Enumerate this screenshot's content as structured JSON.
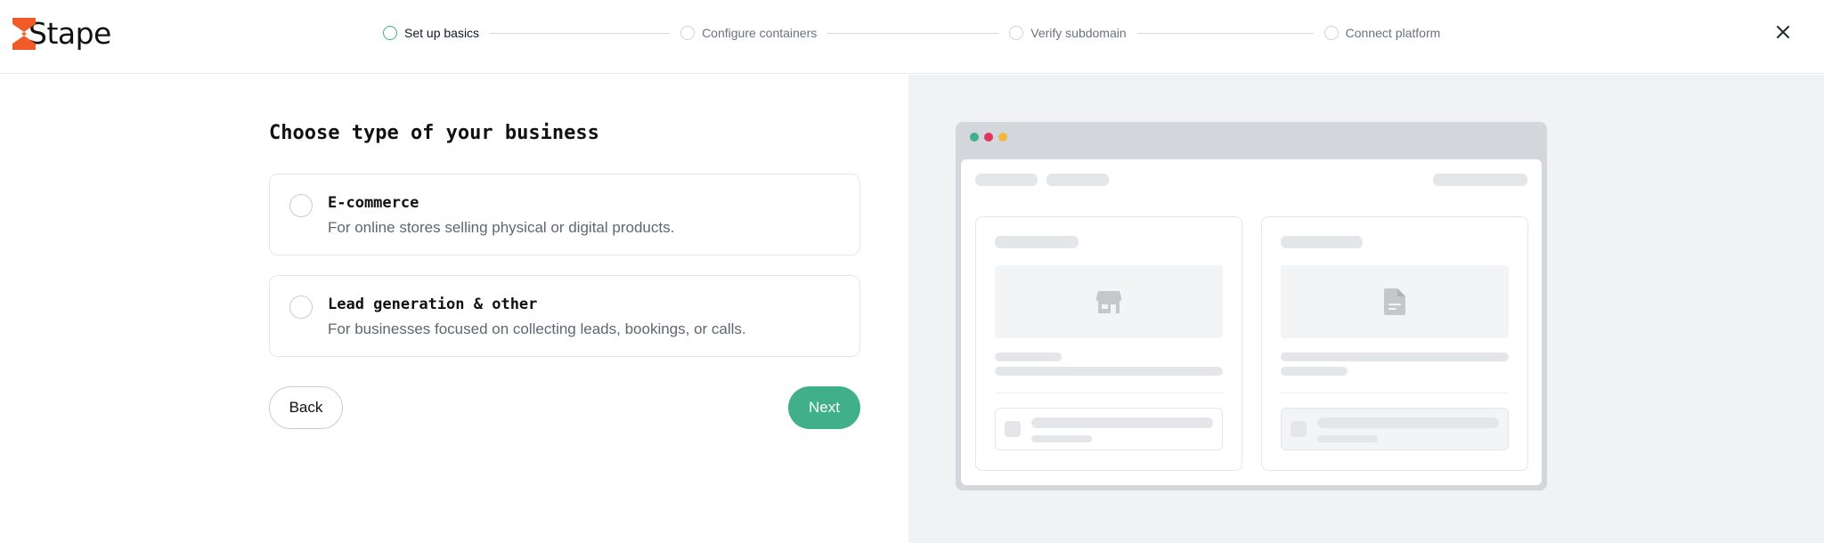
{
  "app": {
    "logo_text": "Stape",
    "brand_color": "#3fb08a",
    "logo_accent_color": "#f15a29"
  },
  "stepper": {
    "steps": [
      {
        "label": "Set up basics",
        "active": true
      },
      {
        "label": "Configure containers",
        "active": false
      },
      {
        "label": "Verify subdomain",
        "active": false
      },
      {
        "label": "Connect platform",
        "active": false
      }
    ]
  },
  "main": {
    "heading": "Choose type of your business",
    "options": [
      {
        "title": "E-commerce",
        "description": "For online stores selling physical or digital products.",
        "icon": "store-icon",
        "selected": false
      },
      {
        "title": "Lead generation & other",
        "description": "For businesses focused on collecting leads, bookings, or calls.",
        "icon": "document-icon",
        "selected": false
      }
    ],
    "back_label": "Back",
    "next_label": "Next"
  },
  "preview": {
    "window_dots": [
      "#3fb08a",
      "#e0365c",
      "#f4b73d"
    ]
  }
}
